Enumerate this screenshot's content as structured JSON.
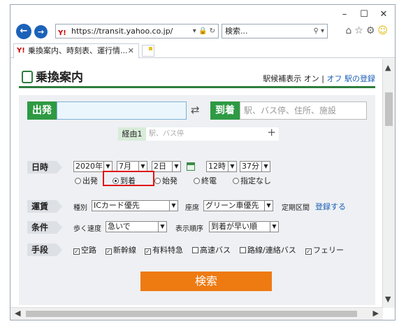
{
  "browser": {
    "address": "https://transit.yahoo.co.jp/",
    "search_placeholder": "検索...",
    "tab_title": "乗換案内、時刻表、運行情...",
    "favicon_text": "Y!"
  },
  "header": {
    "logo": "乗換案内",
    "suggest_label": "駅候補表示",
    "on_label": "オン",
    "separator": "|",
    "off_label": "オフ",
    "register_link": "駅の登録"
  },
  "form": {
    "departure_label": "出発",
    "departure_value": "",
    "arrival_label": "到着",
    "arrival_placeholder": "駅、バス停、住所、施設",
    "via_label": "経由1",
    "via_placeholder": "駅、バス停",
    "datetime_label": "日時",
    "year": "2020年",
    "month": "7月",
    "day": "2日",
    "hour": "12時",
    "minute": "37分",
    "time_modes": [
      {
        "label": "出発",
        "selected": false
      },
      {
        "label": "到着",
        "selected": true
      },
      {
        "label": "始発",
        "selected": false
      },
      {
        "label": "終電",
        "selected": false
      },
      {
        "label": "指定なし",
        "selected": false
      }
    ],
    "fare_label": "運賃",
    "type_label": "種別",
    "type_value": "ICカード優先",
    "seat_label": "座席",
    "seat_value": "グリーン車優先",
    "commuter_label": "定期区間",
    "commuter_link": "登録する",
    "condition_label": "条件",
    "walk_label": "歩く速度",
    "walk_value": "急いで",
    "order_label": "表示順序",
    "order_value": "到着が早い順",
    "means_label": "手段",
    "means": [
      {
        "label": "空路",
        "checked": true
      },
      {
        "label": "新幹線",
        "checked": true
      },
      {
        "label": "有料特急",
        "checked": true
      },
      {
        "label": "高速バス",
        "checked": false
      },
      {
        "label": "路線/連絡バス",
        "checked": false
      },
      {
        "label": "フェリー",
        "checked": true
      }
    ],
    "search_button": "検索"
  }
}
